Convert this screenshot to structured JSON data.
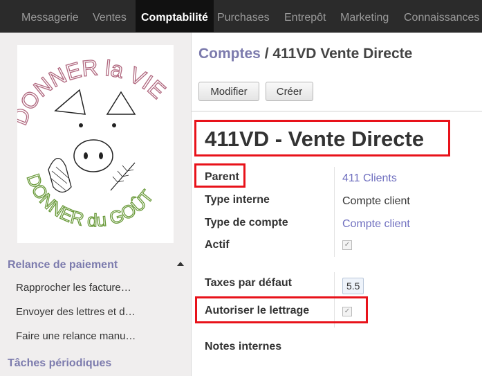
{
  "nav": {
    "items": [
      "Messagerie",
      "Ventes",
      "Comptabilité",
      "Purchases",
      "Entrepôt",
      "Marketing",
      "Connaissances"
    ],
    "active": "Comptabilité"
  },
  "sidebar": {
    "logo": {
      "top_text": "DONNER la VIE",
      "bottom_text": "DONNER du GOÛT"
    },
    "sections": [
      {
        "title": "Relance de paiement",
        "items": [
          "Rapprocher les facture…",
          "Envoyer des lettres et d…",
          "Faire une relance manu…"
        ]
      },
      {
        "title": "Tâches périodiques",
        "items": []
      }
    ]
  },
  "breadcrumb": {
    "parent": "Comptes",
    "separator": "/",
    "current": "411VD Vente Directe"
  },
  "buttons": {
    "edit": "Modifier",
    "create": "Créer"
  },
  "form": {
    "title": "411VD - Vente Directe",
    "fields": {
      "parent": {
        "label": "Parent",
        "value": "411 Clients"
      },
      "internal_type": {
        "label": "Type interne",
        "value": "Compte client"
      },
      "account_type": {
        "label": "Type de compte",
        "value": "Compte client"
      },
      "active": {
        "label": "Actif",
        "checked": true
      },
      "default_taxes": {
        "label": "Taxes par défaut",
        "value": "5.5"
      },
      "reconcile": {
        "label": "Autoriser le lettrage",
        "checked": true
      },
      "notes": {
        "label": "Notes internes"
      }
    }
  },
  "colors": {
    "highlight": "#e8121a",
    "link": "#7c7bad",
    "navbar": "#2b2b2b"
  }
}
